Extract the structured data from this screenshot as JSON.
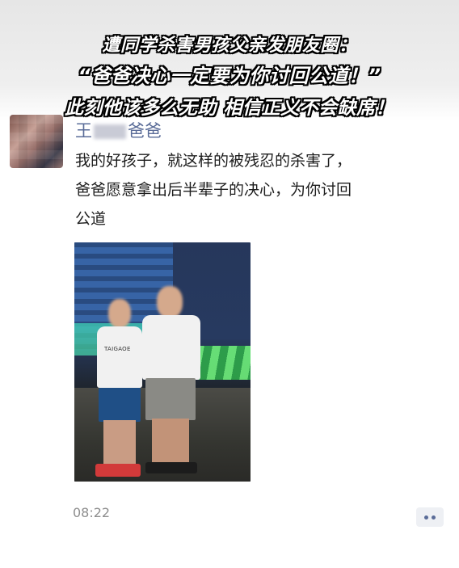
{
  "headline": {
    "line1": "遭同学杀害男孩父亲发朋友圈：",
    "line2": "“爸爸决心一定要为你讨回公道！”",
    "line3": "此刻他该多么无助 相信正义不会缺席！"
  },
  "post": {
    "author_prefix": "王",
    "author_suffix": "爸爸",
    "lines": [
      "我的好孩子，就这样的被残忍的杀害了，",
      "爸爸愿意拿出后半辈子的决心，为你讨回",
      "公道"
    ],
    "time": "08:22"
  },
  "photo": {
    "shirt_text": "TAIGAOE"
  },
  "icons": {
    "more": "more-dots-icon"
  }
}
